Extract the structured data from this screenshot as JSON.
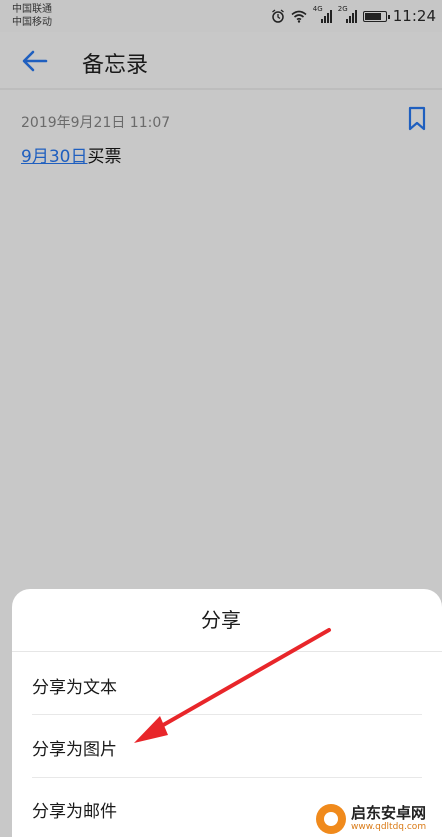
{
  "status_bar": {
    "carrier_1": "中国联通",
    "carrier_2": "中国移动",
    "network_1": "4G",
    "network_2": "2G",
    "time": "11:24",
    "battery_level": 0.85,
    "icons": [
      "alarm-icon",
      "wifi-icon",
      "signal-icon",
      "signal-icon",
      "battery-icon"
    ]
  },
  "header": {
    "title": "备忘录",
    "back_icon": "back-arrow-icon"
  },
  "note": {
    "timestamp": "2019年9月21日 11:07",
    "link_text": "9月30日",
    "body_rest": "买票",
    "bookmark_icon": "bookmark-icon"
  },
  "share_sheet": {
    "title": "分享",
    "items": [
      {
        "label": "分享为文本"
      },
      {
        "label": "分享为图片"
      },
      {
        "label": "分享为邮件"
      }
    ]
  },
  "watermark": {
    "name": "启东安卓网",
    "url": "www.qdltdq.com"
  },
  "colors": {
    "accent": "#1f5fbf",
    "annotation_arrow": "#e8262a",
    "dim_background": "#c8c8c8",
    "sheet_background": "#ffffff"
  }
}
